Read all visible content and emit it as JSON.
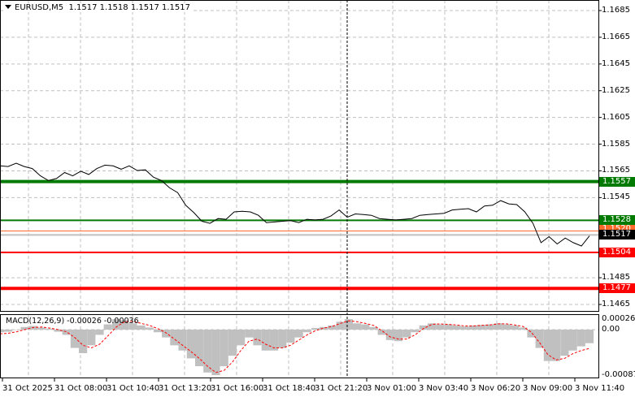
{
  "header": {
    "symbol": "EURUSD,M5",
    "ohlc": "1.1517 1.1518 1.1517 1.1517"
  },
  "macd": {
    "title": "MACD(12,26,9) -0.00026 -0.00036",
    "scale_labels": [
      "0.00026",
      "0.00",
      "-0.00087"
    ]
  },
  "price_axis": {
    "labels": [
      "1.1685",
      "1.1665",
      "1.1645",
      "1.1625",
      "1.1605",
      "1.1585",
      "1.1565",
      "1.1545",
      "1.1485",
      "1.1465"
    ]
  },
  "levels": [
    {
      "name": "resistance-2",
      "price": "1.1557",
      "color": "#007a00",
      "thick": true
    },
    {
      "name": "resistance-1",
      "price": "1.1528",
      "color": "#007a00",
      "thick": false
    },
    {
      "name": "bid-line",
      "price": "1.1520",
      "color": "#ff6a2a",
      "thick": false
    },
    {
      "name": "current-price",
      "price": "1.1517",
      "color": "#000000",
      "thick": false
    },
    {
      "name": "support-1",
      "price": "1.1504",
      "color": "#ff0000",
      "thick": false
    },
    {
      "name": "support-2",
      "price": "1.1477",
      "color": "#ff0000",
      "thick": true
    }
  ],
  "time_axis": {
    "labels": [
      "31 Oct 2025",
      "31 Oct 08:00",
      "31 Oct 10:40",
      "31 Oct 13:20",
      "31 Oct 16:00",
      "31 Oct 18:40",
      "31 Oct 21:20",
      "3 Nov 01:00",
      "3 Nov 03:40",
      "3 Nov 06:20",
      "3 Nov 09:00",
      "3 Nov 11:40"
    ]
  },
  "chart_data": {
    "type": "line",
    "price_range": [
      1.1465,
      1.1685
    ],
    "price_series": [
      1.1568,
      1.1569,
      1.157,
      1.1569,
      1.1566,
      1.1562,
      1.1557,
      1.156,
      1.1563,
      1.1562,
      1.1564,
      1.1563,
      1.1566,
      1.157,
      1.1568,
      1.1567,
      1.1568,
      1.1566,
      1.1565,
      1.1561,
      1.1557,
      1.1553,
      1.1548,
      1.154,
      1.1533,
      1.1528,
      1.1525,
      1.153,
      1.1528,
      1.1535,
      1.1534,
      1.1535,
      1.1531,
      1.1527,
      1.1526,
      1.1528,
      1.1527,
      1.1527,
      1.1528,
      1.1529,
      1.1528,
      1.1532,
      1.1535,
      1.1531,
      1.1532,
      1.1533,
      1.1531,
      1.153,
      1.1528,
      1.1529,
      1.1528,
      1.153,
      1.1531,
      1.1533,
      1.1532,
      1.1534,
      1.1535,
      1.1537,
      1.1536,
      1.1535,
      1.1538,
      1.154,
      1.1542,
      1.1541,
      1.1539,
      1.1535,
      1.1525,
      1.1512,
      1.1515,
      1.1511,
      1.1514,
      1.1512,
      1.1508,
      1.1517
    ],
    "macd_range": [
      -0.00087,
      0.00026
    ],
    "macd_histogram": [
      -5e-05,
      -4e-05,
      0.0,
      5e-05,
      7e-05,
      4e-05,
      2e-05,
      -4e-05,
      -0.0001,
      -0.00035,
      -0.00045,
      -0.0003,
      -0.0001,
      0.0001,
      0.0002,
      0.00018,
      0.00012,
      8e-05,
      4e-05,
      -5e-05,
      -0.00015,
      -0.0003,
      -0.0004,
      -0.00055,
      -0.0007,
      -0.00082,
      -0.00087,
      -0.0007,
      -0.0005,
      -0.0003,
      -0.00015,
      -0.0003,
      -0.0004,
      -0.0004,
      -0.00035,
      -0.00025,
      -0.00015,
      -5e-05,
      3e-05,
      5e-05,
      8e-05,
      0.00015,
      0.0002,
      0.00012,
      0.0001,
      5e-05,
      -0.0001,
      -0.0002,
      -0.00022,
      -0.00015,
      -5e-05,
      8e-05,
      0.00012,
      0.0001,
      0.0001,
      8e-05,
      6e-05,
      8e-05,
      9e-05,
      0.0001,
      0.00012,
      0.0001,
      8e-05,
      4e-05,
      -0.00015,
      -0.00035,
      -0.0006,
      -0.0006,
      -0.0005,
      -0.0004,
      -0.00032,
      -0.00026
    ],
    "macd_signal": [
      -8e-05,
      -7e-05,
      -4e-05,
      0.0,
      4e-05,
      5e-05,
      3e-05,
      0.0,
      -4e-05,
      -0.00015,
      -0.0003,
      -0.00035,
      -0.00028,
      -0.00012,
      5e-05,
      0.00015,
      0.00016,
      0.00012,
      8e-05,
      2e-05,
      -6e-05,
      -0.00018,
      -0.0003,
      -0.00042,
      -0.00055,
      -0.0007,
      -0.00082,
      -0.00078,
      -0.00062,
      -0.0004,
      -0.00022,
      -0.00018,
      -0.00028,
      -0.00035,
      -0.00035,
      -0.0003,
      -0.0002,
      -0.0001,
      -2e-05,
      3e-05,
      6e-05,
      0.00012,
      0.00017,
      0.00015,
      0.00012,
      8e-05,
      -2e-05,
      -0.00014,
      -0.00018,
      -0.00018,
      -0.0001,
      2e-05,
      0.0001,
      0.00011,
      0.0001,
      9e-05,
      7e-05,
      7e-05,
      8e-05,
      9e-05,
      0.00011,
      0.00011,
      9e-05,
      6e-05,
      -5e-05,
      -0.00025,
      -0.00048,
      -0.00058,
      -0.00055,
      -0.00046,
      -0.0004,
      -0.00036
    ]
  }
}
